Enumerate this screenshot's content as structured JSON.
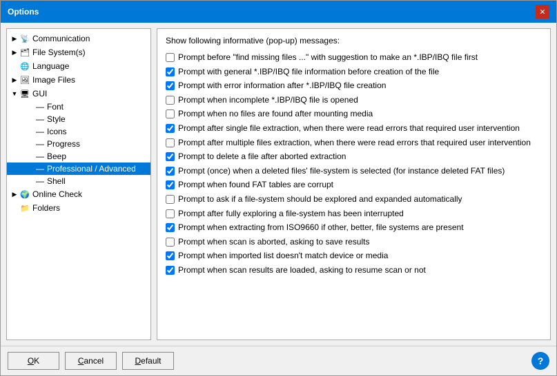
{
  "dialog": {
    "title": "Options",
    "close_label": "✕"
  },
  "sidebar": {
    "items": [
      {
        "id": "communication",
        "label": "Communication",
        "level": 1,
        "toggle": "▶",
        "icon": "📡",
        "expanded": false
      },
      {
        "id": "filesystem",
        "label": "File System(s)",
        "level": 1,
        "toggle": "▶",
        "icon": "🗂",
        "expanded": false
      },
      {
        "id": "language",
        "label": "Language",
        "level": 1,
        "toggle": "",
        "icon": "🌐",
        "expanded": false
      },
      {
        "id": "imagefiles",
        "label": "Image Files",
        "level": 1,
        "toggle": "▶",
        "icon": "🖼",
        "expanded": false
      },
      {
        "id": "gui",
        "label": "GUI",
        "level": 1,
        "toggle": "▼",
        "icon": "🖥",
        "expanded": true
      },
      {
        "id": "font",
        "label": "Font",
        "level": 2,
        "toggle": "",
        "icon": ""
      },
      {
        "id": "style",
        "label": "Style",
        "level": 2,
        "toggle": "",
        "icon": ""
      },
      {
        "id": "icons",
        "label": "Icons",
        "level": 2,
        "toggle": "",
        "icon": ""
      },
      {
        "id": "progress",
        "label": "Progress",
        "level": 2,
        "toggle": "",
        "icon": ""
      },
      {
        "id": "beep",
        "label": "Beep",
        "level": 2,
        "toggle": "",
        "icon": ""
      },
      {
        "id": "profadv",
        "label": "Professional / Advanced",
        "level": 2,
        "toggle": "",
        "icon": ""
      },
      {
        "id": "shell",
        "label": "Shell",
        "level": 2,
        "toggle": "",
        "icon": ""
      },
      {
        "id": "onlinecheck",
        "label": "Online Check",
        "level": 1,
        "toggle": "▶",
        "icon": "🌍",
        "expanded": false
      },
      {
        "id": "folders",
        "label": "Folders",
        "level": 1,
        "toggle": "",
        "icon": "📁",
        "expanded": false
      }
    ]
  },
  "main": {
    "section_title": "Show following informative (pop-up) messages:",
    "checkboxes": [
      {
        "id": "cb1",
        "checked": false,
        "label": "Prompt before \"find missing files ...\" with suggestion to make an *.IBP/IBQ file first"
      },
      {
        "id": "cb2",
        "checked": true,
        "label": "Prompt with general *.IBP/IBQ file information before creation of the file"
      },
      {
        "id": "cb3",
        "checked": true,
        "label": "Prompt with error information after *.IBP/IBQ file creation"
      },
      {
        "id": "cb4",
        "checked": false,
        "label": "Prompt when incomplete *.IBP/IBQ file is opened"
      },
      {
        "id": "cb5",
        "checked": false,
        "label": "Prompt when no files are found after mounting media"
      },
      {
        "id": "cb6",
        "checked": true,
        "label": "Prompt after single file extraction, when there were read errors that required user intervention"
      },
      {
        "id": "cb7",
        "checked": false,
        "label": "Prompt after multiple files extraction, when there were read errors that required user intervention"
      },
      {
        "id": "cb8",
        "checked": true,
        "label": "Prompt to delete a file after aborted extraction"
      },
      {
        "id": "cb9",
        "checked": true,
        "label": "Prompt (once) when a deleted files' file-system is selected (for instance deleted FAT files)"
      },
      {
        "id": "cb10",
        "checked": true,
        "label": "Prompt when found FAT tables are corrupt"
      },
      {
        "id": "cb11",
        "checked": false,
        "label": "Prompt to ask if a file-system should be explored and expanded automatically"
      },
      {
        "id": "cb12",
        "checked": false,
        "label": "Prompt after fully exploring a file-system has been interrupted"
      },
      {
        "id": "cb13",
        "checked": true,
        "label": "Prompt when extracting from ISO9660 if other, better, file systems are present"
      },
      {
        "id": "cb14",
        "checked": false,
        "label": "Prompt when scan is aborted, asking to save results"
      },
      {
        "id": "cb15",
        "checked": true,
        "label": "Prompt when imported list doesn't match device or media"
      },
      {
        "id": "cb16",
        "checked": true,
        "label": "Prompt when scan results are loaded, asking to resume scan or not"
      }
    ]
  },
  "footer": {
    "ok_label": "OK",
    "cancel_label": "Cancel",
    "default_label": "Default",
    "help_label": "?"
  }
}
